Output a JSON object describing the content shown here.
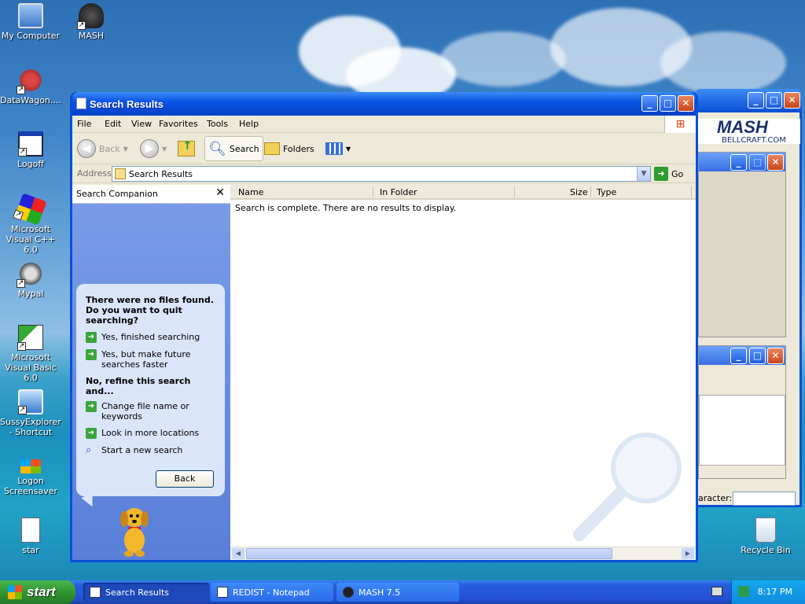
{
  "desktop": {
    "icons": [
      {
        "label": "My Computer"
      },
      {
        "label": "MASH"
      },
      {
        "label": "DataWagon...."
      },
      {
        "label": "Logoff"
      },
      {
        "label": "Microsoft Visual C++ 6.0"
      },
      {
        "label": "Mypal"
      },
      {
        "label": "Microsoft Visual Basic 6.0"
      },
      {
        "label": "SussyExplorer - Shortcut"
      },
      {
        "label": "Logon Screensaver"
      },
      {
        "label": "star"
      },
      {
        "label": "Recycle Bin"
      }
    ]
  },
  "background_window": {
    "logo": "MASH",
    "logo_sub": "BELLCRAFT.COM",
    "field_label": "aracter:"
  },
  "window": {
    "title": "Search Results",
    "menu": [
      "File",
      "Edit",
      "View",
      "Favorites",
      "Tools",
      "Help"
    ],
    "toolbar": {
      "back": "Back",
      "search": "Search",
      "folders": "Folders"
    },
    "address": {
      "label": "Address",
      "value": "Search Results",
      "go": "Go"
    },
    "companion": {
      "title": "Search Companion",
      "question": "There were no files found. Do you want to quit searching?",
      "opt_finished": "Yes, finished searching",
      "opt_faster": "Yes, but make future searches faster",
      "refine": "No, refine this search and...",
      "opt_change": "Change file name or keywords",
      "opt_more": "Look in more locations",
      "opt_new": "Start a new search",
      "back_button": "Back"
    },
    "columns": [
      "Name",
      "In Folder",
      "Size",
      "Type"
    ],
    "message": "Search is complete. There are no results to display."
  },
  "taskbar": {
    "start": "start",
    "tasks": [
      {
        "label": "Search Results"
      },
      {
        "label": "REDIST - Notepad"
      },
      {
        "label": "MASH 7.5"
      }
    ],
    "clock": "8:17 PM"
  },
  "colors": {
    "titlebar": "#0b55e6",
    "start_green": "#2d8f2d",
    "companion_blue": "#5a7fd9"
  }
}
